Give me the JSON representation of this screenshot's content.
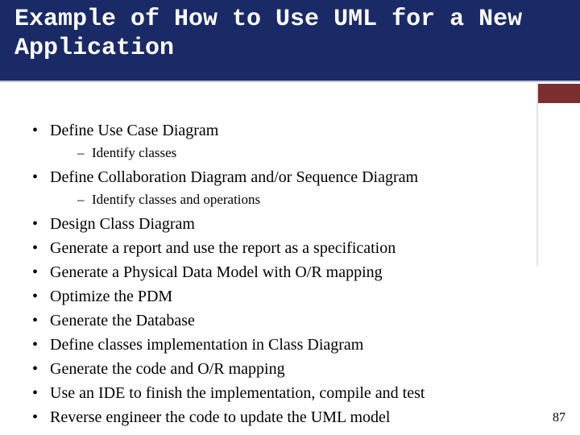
{
  "title": "Example of How to Use UML for a New Application",
  "bullets": {
    "b0": "Define Use Case Diagram",
    "b0s0": "Identify classes",
    "b1": "Define Collaboration Diagram and/or Sequence Diagram",
    "b1s0": "Identify classes and operations",
    "b2": "Design Class Diagram",
    "b3": "Generate a report and use the report as a specification",
    "b4": "Generate a Physical Data Model with O/R mapping",
    "b5": "Optimize the PDM",
    "b6": "Generate the Database",
    "b7": "Define classes implementation in Class Diagram",
    "b8": "Generate the code and O/R mapping",
    "b9": "Use an IDE to finish the implementation, compile and test",
    "b10": "Reverse engineer the code to update the UML model"
  },
  "page_number": "87"
}
